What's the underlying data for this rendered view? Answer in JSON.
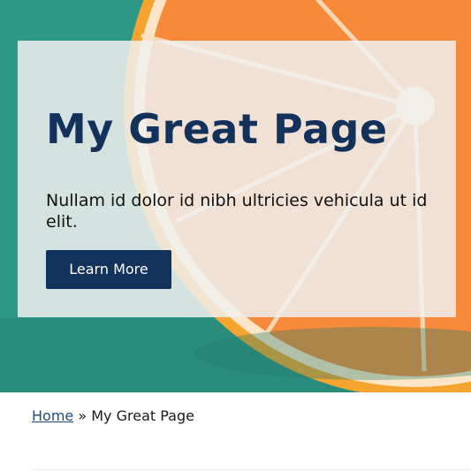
{
  "hero": {
    "title": "My Great Page",
    "lede": "Nullam id dolor id nibh ultricies vehicula ut id elit.",
    "cta_label": "Learn More",
    "background_color": "#2f9a8a",
    "card_color": "#f0f0ee",
    "accent_color": "#12325c"
  },
  "breadcrumb": {
    "home_label": "Home",
    "separator": "»",
    "current_label": "My Great Page"
  }
}
